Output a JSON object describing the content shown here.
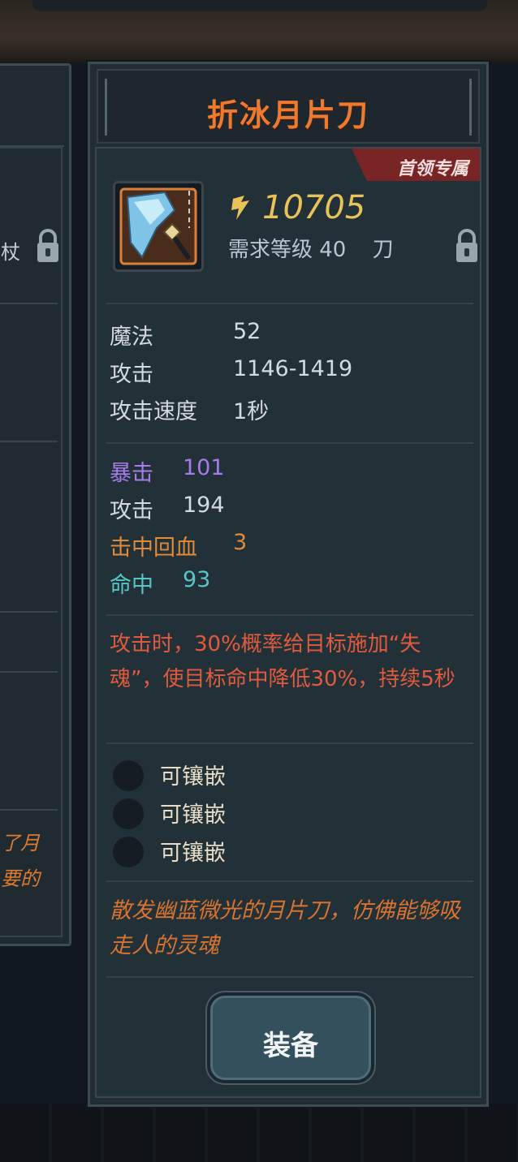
{
  "item": {
    "name": "折冰月片刀",
    "badge": "首领专属",
    "power": "10705",
    "requirement": "需求等级 40",
    "weapon_type": "刀"
  },
  "base_stats": [
    {
      "label": "魔法",
      "value": "52"
    },
    {
      "label": "攻击",
      "value": "1146-1419"
    },
    {
      "label": "攻击速度",
      "value": "1秒"
    }
  ],
  "bonus_stats": [
    {
      "label": "暴击",
      "value": "101",
      "color": "#a77bea"
    },
    {
      "label": "攻击",
      "value": "194",
      "color": "#d4dbe0"
    },
    {
      "label": "击中回血",
      "value": "3",
      "color": "#e08a3a"
    },
    {
      "label": "命中",
      "value": "93",
      "color": "#56c6c6"
    }
  ],
  "effect": "攻击时，30%概率给目标施加“失魂”，使目标命中降低30%，持续5秒",
  "sockets": [
    "可镶嵌",
    "可镶嵌",
    "可镶嵌"
  ],
  "flavor": "散发幽蓝微光的月片刀，仿佛能够吸走人的灵魂",
  "equip_label": "装备",
  "left_panel": {
    "row_text": "杖",
    "flavor_line1": "了月",
    "flavor_line2": "要的"
  },
  "colors": {
    "title": "#ee7a2f",
    "power": "#e9c35a",
    "effect": "#e25a3e",
    "flavor": "#d9732f"
  },
  "icons": [
    "sword-icon",
    "power-icon",
    "lock-icon",
    "socket-icon"
  ]
}
